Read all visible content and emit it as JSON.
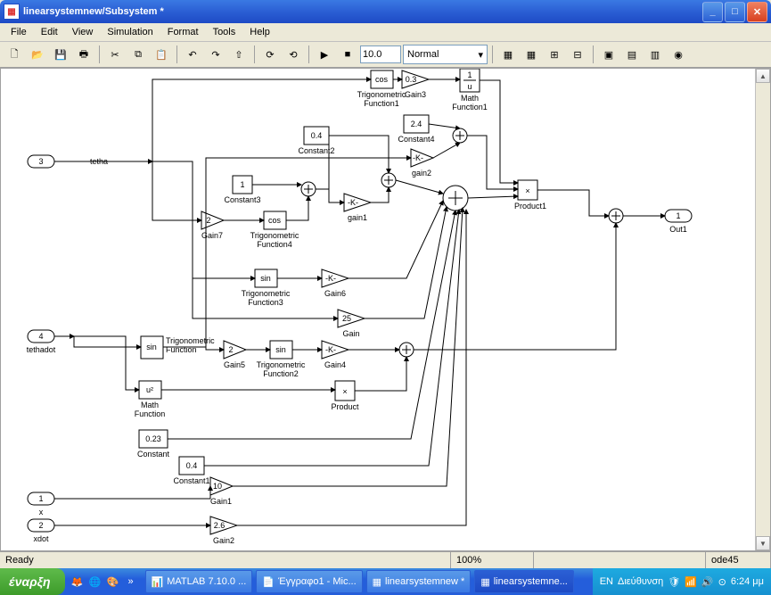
{
  "window": {
    "title": "linearsystemnew/Subsystem *"
  },
  "menu": {
    "file": "File",
    "edit": "Edit",
    "view": "View",
    "simulation": "Simulation",
    "format": "Format",
    "tools": "Tools",
    "help": "Help"
  },
  "toolbar": {
    "stoptime": "10.0",
    "mode": "Normal"
  },
  "status": {
    "ready": "Ready",
    "zoom": "100%",
    "solver": "ode45"
  },
  "blocks": {
    "in3": {
      "num": "3",
      "label": "tetha"
    },
    "in4": {
      "num": "4",
      "label": "tethadot"
    },
    "in1": {
      "num": "1",
      "label": "x"
    },
    "in2": {
      "num": "2",
      "label": "xdot"
    },
    "out1": {
      "num": "1",
      "label": "Out1"
    },
    "trig1": {
      "fn": "cos",
      "label": "Trigonometric\nFunction1"
    },
    "trig2": {
      "fn": "sin",
      "label": "Trigonometric\nFunction2"
    },
    "trig3": {
      "fn": "sin",
      "label": "Trigonometric\nFunction3"
    },
    "trig4": {
      "fn": "cos",
      "label": "Trigonometric\nFunction4"
    },
    "trigblk": {
      "fn": "sin",
      "label": "Trigonometric\nFunction"
    },
    "gain1": {
      "k": "10",
      "label": "Gain1"
    },
    "gain2": {
      "k": "-K-",
      "label": "gain2"
    },
    "gain3": {
      "k": "0.3",
      "label": "Gain3"
    },
    "gain4": {
      "k": "-K-",
      "label": "Gain4"
    },
    "gain5": {
      "k": "2",
      "label": "Gain5"
    },
    "gain6": {
      "k": "-K-",
      "label": "Gain6"
    },
    "gain7": {
      "k": "2",
      "label": "Gain7"
    },
    "gain": {
      "k": "25",
      "label": "Gain"
    },
    "gain_t1": {
      "k": "-K-",
      "label": "gain1"
    },
    "gain_b2": {
      "k": "2.6",
      "label": "Gain2"
    },
    "const": {
      "v": "0.23",
      "label": "Constant"
    },
    "const1": {
      "v": "0.4",
      "label": "Constant1"
    },
    "const2": {
      "v": "0.4",
      "label": "Constant2"
    },
    "const3": {
      "v": "1",
      "label": "Constant3"
    },
    "const4": {
      "v": "2.4",
      "label": "Constant4"
    },
    "math": {
      "expr": "u²",
      "label": "Math\nFunction"
    },
    "math1": {
      "expr": "1\nu",
      "label": "Math\nFunction1"
    },
    "product": {
      "label": "Product",
      "sym": "×"
    },
    "product1": {
      "label": "Product1",
      "sym": "×"
    }
  },
  "taskbar": {
    "start": "έναρξη",
    "t1": "MATLAB 7.10.0 ...",
    "t2": "Έγγραφο1 - Mic...",
    "t3": "linearsystemnew *",
    "t4": "linearsystemne...",
    "lang": "EN",
    "addr": "Διεύθυνση",
    "clock": "6:24 μμ"
  }
}
